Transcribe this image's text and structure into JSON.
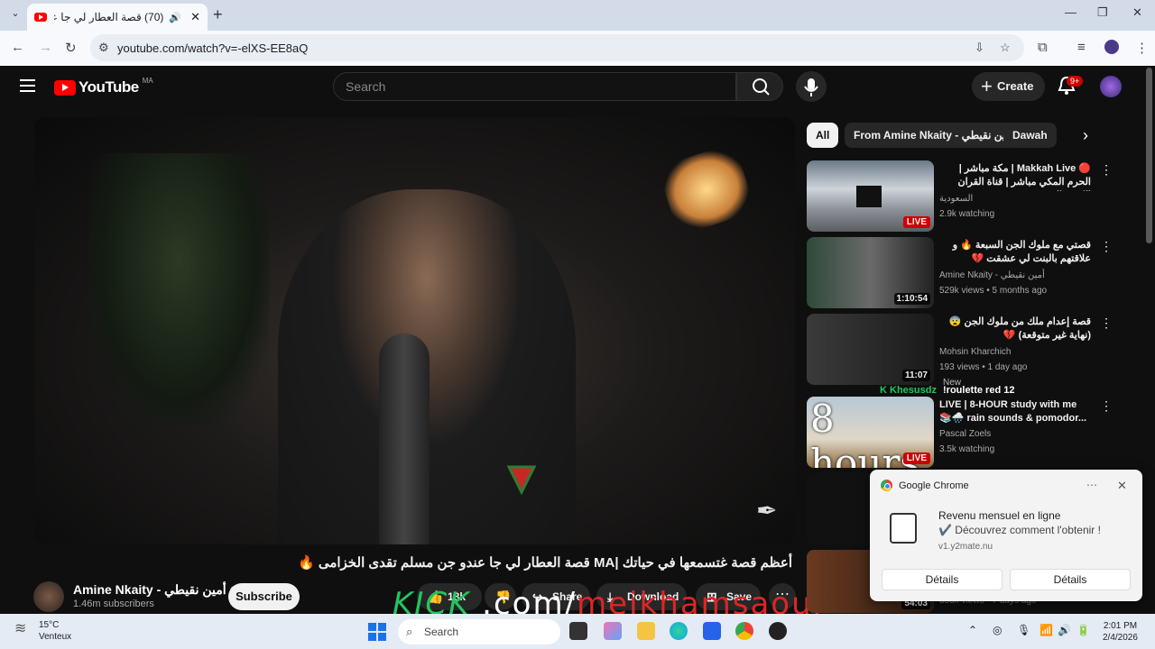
{
  "browser": {
    "tab_title": "(70) قصة العطار لي جا عندو",
    "address": "youtube.com/watch?v=-elXS-EE8aQ"
  },
  "youtube": {
    "logo_text": "YouTube",
    "country_code": "MA",
    "search_placeholder": "Search",
    "create_label": "Create",
    "notif_count": "9+"
  },
  "video": {
    "title": "أعظم قصة غتسمعها في حياتك |MA قصة العطار لي جا عندو جن مسلم تقدى الخزامى 🔥",
    "channel": "Amine Nkaity - أمين نقيطي",
    "subscribers": "1.46m subscribers",
    "subscribe_label": "Subscribe",
    "likes": "18k",
    "share_label": "Share",
    "download_label": "Download",
    "save_label": "Save"
  },
  "overlay_text": {
    "kick": "KICK",
    "com": ".com/",
    "name": "meikhamsaoui"
  },
  "chips": [
    "All",
    "From Amine Nkaity - أمين نقيطي",
    "Dawah"
  ],
  "recommendations": [
    {
      "title": "🔴 Makkah Live | مكة مباشر | الحرم المكي مباشر | قناة القران الكريم السعودية ...",
      "channel": "السعودية",
      "meta": "2.9k watching",
      "badge": "LIVE"
    },
    {
      "title": "قصتي مع ملوك الجن السبعة 🔥 و علاقتهم بالبنت لي عشقت 💔",
      "channel": "Amine Nkaity - أمين نقيطي",
      "meta": "529k views • 5 months ago",
      "badge": "1:10:54"
    },
    {
      "title": "قصة إعدام ملك من ملوك الجن 😨 (نهاية غير متوقعة) 💔",
      "channel": "Mohsin Kharchich",
      "meta": "193 views • 1 day ago",
      "badge": "11:07"
    },
    {
      "title": "LIVE | 8-HOUR study with me 📚🌧️ rain sounds & pomodor...",
      "channel": "Pascal Zoels",
      "meta": "3.5k watching",
      "badge": "LIVE"
    },
    {
      "title": "",
      "channel": "",
      "meta": "",
      "badge": ""
    },
    {
      "title": "",
      "channel": "",
      "meta": "353k views • 7 days ago",
      "badge": "54:03"
    }
  ],
  "kick_chat": {
    "badge": "New",
    "user": "Khesusdz",
    "message": "!roulette red 12"
  },
  "notification": {
    "app": "Google Chrome",
    "title": "Revenu mensuel en ligne",
    "body": "✔️ Découvrez comment l'obtenir !",
    "source": "v1.y2mate.nu",
    "btn1": "Détails",
    "btn2": "Détails"
  },
  "taskbar": {
    "temp": "15°C",
    "weather": "Venteux",
    "search": "Search",
    "time": "2:01 PM",
    "date": "2/4/2026"
  },
  "colors": {
    "youtube_red": "#ff0000",
    "kick_green": "#22c55e",
    "overlay_red": "#dc2626"
  }
}
